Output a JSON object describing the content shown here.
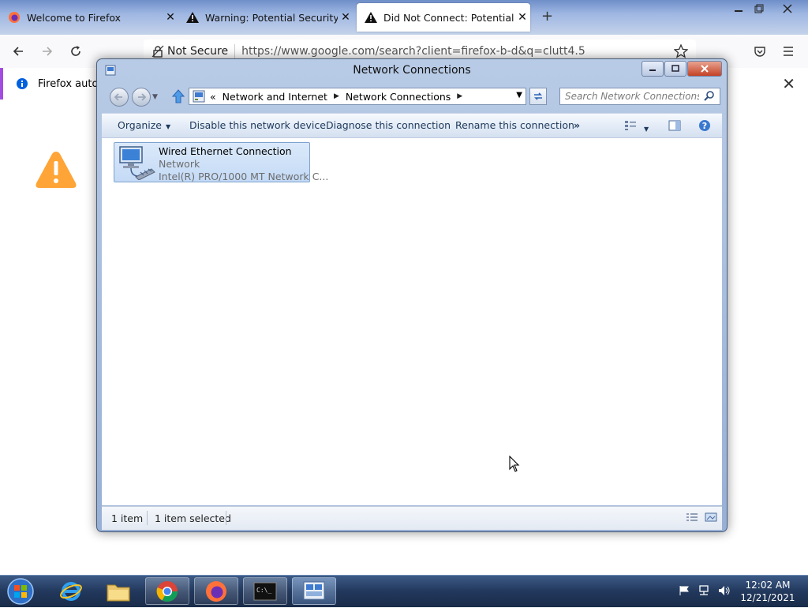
{
  "firefox": {
    "tabs": [
      {
        "title": "Welcome to Firefox",
        "icon": "firefox-icon"
      },
      {
        "title": "Warning: Potential Security Risk Ahead",
        "icon": "warning-icon"
      },
      {
        "title": "Did Not Connect: Potential Security Issue",
        "icon": "warning-icon"
      }
    ],
    "new_tab_label": "+",
    "url_security": "Not Secure",
    "url": "https://www.google.com/search?client=firefox-b-d&q=clutt4.5",
    "notification": "Firefox automa",
    "close_glyph": "✕"
  },
  "explorer": {
    "title": "Network Connections",
    "breadcrumb": {
      "overflow": "«",
      "items": [
        "Network and Internet",
        "Network Connections"
      ]
    },
    "search_placeholder": "Search Network Connections",
    "commands": {
      "organize": "Organize",
      "disable": "Disable this network device",
      "diagnose": "Diagnose this connection",
      "rename": "Rename this connection",
      "more": "»"
    },
    "items": [
      {
        "name": "Wired Ethernet Connection",
        "status": "Network",
        "device": "Intel(R) PRO/1000 MT Network C..."
      }
    ],
    "status": {
      "count": "1 item",
      "selected": "1 item selected"
    }
  },
  "taskbar": {
    "time": "12:02 AM",
    "date": "12/21/2021"
  },
  "colors": {
    "accent": "#a34ce0",
    "warning": "#ffa436",
    "selection": "#c4daf6"
  }
}
